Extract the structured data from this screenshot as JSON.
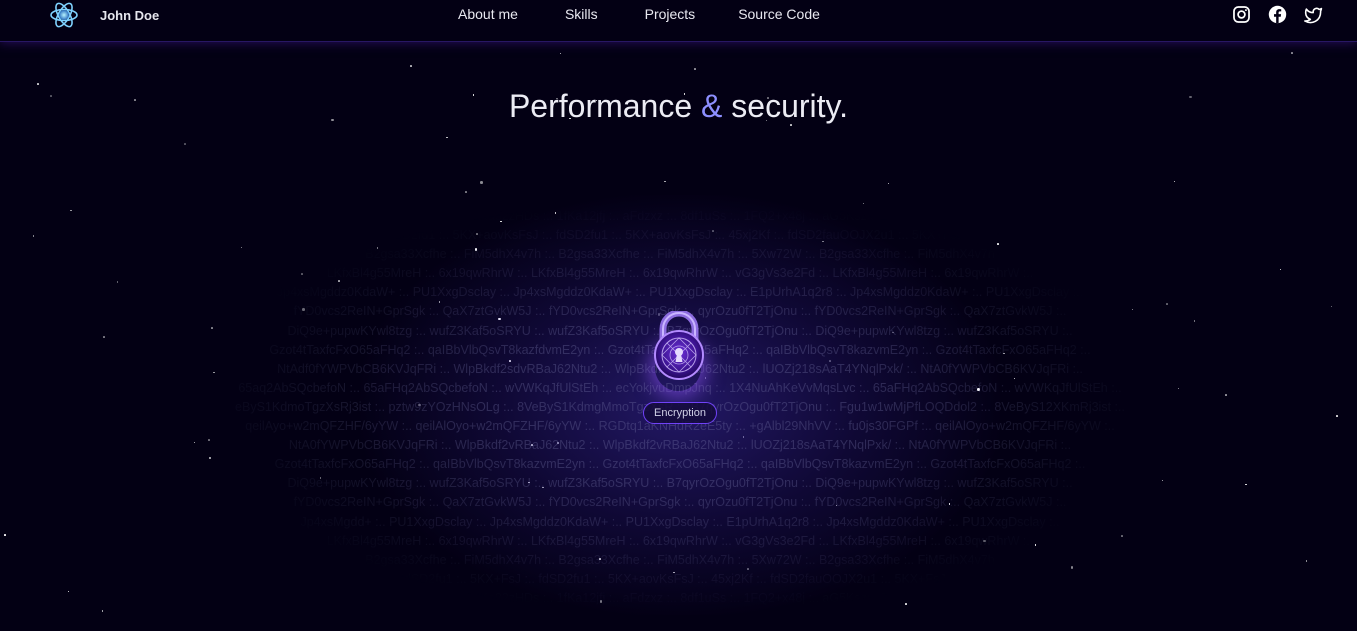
{
  "header": {
    "brand_name": "John Doe",
    "logo_icon": "atom-logo-icon",
    "nav": [
      "About me",
      "Skills",
      "Projects",
      "Source Code"
    ],
    "socials": [
      "instagram-icon",
      "facebook-icon",
      "twitter-icon"
    ]
  },
  "hero": {
    "title_part1": "Performance ",
    "title_amp": "&",
    "title_part2": " security."
  },
  "encryption": {
    "lock_icon": "lock-icon",
    "label": "Encryption",
    "background_lines": [
      "8dKa82zHDs :.. 1fKa12jfj :.. aFdzxz :.. 8df1uSs :.. 1FQ2+x48j :.. aG5Kszx+2..",
      "fdSD2fu1 :.. 5KX+aovKsFsJ :.. fdSD2fu1 :.. 5KX+aovKsFsJ :.. 45xj2Kf :.. fdSD2fauOOJX2u1 :.. 5KX+FsJ :..",
      "B2gsa33Xcfhe :.. FiM5dhX4v7h :.. B2gsa33Xcfhe :.. FiM5dhX4v7h :.. 5Xw72W :.. B2gsa33Xcfhe :.. FiM5dhX4v7h",
      "LKfxBl4g55MreH :.. 6x19qwRhrW :.. LKfxBl4g55MreH :.. 6x19qwRhrW :.. vG3gVs3e2Fd :.. LKfxBl4g55MreH :.. 6x19qwRhrW :..",
      "Jp4xsMgddz0KdaW+ :.. PU1XxgDsclay :.. Jp4xsMgddz0KdaW+ :.. PU1XxgDsclay :.. E1pUrhA1q2r8 :.. Jp4xsMgddz0KdaW+ :.. PU1XxgDsclay :..",
      "fYD0vcs2ReIN+GprSgk :.. QaX7ztGvkW5J :.. fYD0vcs2ReIN+GprSgk :.. qyrOzu0fT2TjOnu :.. fYD0vcs2ReIN+GprSgk :.. QaX7ztGvkW5J :..",
      "DiQ9e+pupwKYwl8tzg :.. wufZ3Kaf5oSRYU :.. wufZ3Kaf5oSRYU :.. B7qyrOzOgu0fT2TjOnu :.. DiQ9e+pupwKYwl8tzg :.. wufZ3Kaf5oSRYU :..",
      "Gzot4tTaxfcFxO65aFHq2 :.. qaIBbVlbQsvT8kazfdvmE2yn :.. Gzot4tTaxfcFxO65aFHq2 :.. qaIBbVlbQsvT8kazvmE2yn :.. Gzot4tTaxfcFxO65aFHq2 :..",
      "NtAdf0fYWPVbCB6KVJqFRi :.. WlpBkdf2sdvRBaJ62Ntu2 :.. WlpBkdf2vRBaJ62Ntu2 :.. lUOZj218sAaT4YNqlPxk/ :.. NtA0fYWPVbCB6KVJqFRi :..",
      "65aq2AbSQcbefoN :.. 65aFHq2AbSQcbefoN :.. wVWKqJfUlStEh :.. ecYokjvuDmpJnq :.. 1X4NuAhKeVvMqsLvc :.. 65aFHq2AbSQcbefoN :.. wVWKqJfUlStEh :..",
      "eByS1KdmoTgzXsRj3ist :.. pztw9zYOzHNsOLg :.. 8VeByS1KdmgMmoTgzXsR :.. B7qyrOzOgu0fT2TjOnu :.. Fgu1w1wMjPfLOQDdol2 :.. 8VeByS12XKmRj3ist :..",
      "qeilAyo+w2mQFZHF/6yYW :.. qeilAlOyo+w2mQFZHF/6yYW :.. RGDtq1aKNHdR2eE5ty :.. +gAlbl29NhVV :.. fu0js30FGPf :.. qeilAlOyo+w2mQFZHF/6yYW :..",
      "NtA0fYWPVbCB6KVJqFRi :.. WlpBkdf2vRBaJ62Ntu2 :.. WlpBkdf2vRBaJ62Ntu2 :.. lUOZj218sAaT4YNqlPxk/ :.. NtA0fYWPVbCB6KVJqFRi :..",
      "Gzot4tTaxfcFxO65aFHq2 :.. qaIBbVlbQsvT8kazvmE2yn :.. Gzot4tTaxfcFxO65aFHq2 :.. qaIBbVlbQsvT8kazvmE2yn :.. Gzot4tTaxfcFxO65aFHq2 :..",
      "DiQ9e+pupwKYwl8tzg :.. wufZ3Kaf5oSRYU :.. wufZ3Kaf5oSRYU :.. B7qyrOzOgu0fT2TjOnu :.. DiQ9e+pupwKYwl8tzg :.. wufZ3Kaf5oSRYU :..",
      "fYD0vcs2ReIN+GprSgk :.. QaX7ztGvkW5J :.. fYD0vcs2ReIN+GprSgk :.. qyrOzu0fT2TjOnu :.. fYD0vcs2ReIN+GprSgk :.. QaX7ztGvkW5J :..",
      "Jp4xsMgdd+ :.. PU1XxgDsclay :.. Jp4xsMgddz0KdaW+ :.. PU1XxgDsclay :.. E1pUrhA1q2r8 :.. Jp4xsMgddz0KdaW+ :.. PU1XxgDsclay :..",
      "LKfxBl4g55MreH :.. 6x19qwRhrW :.. LKfxBl4g55MreH :.. 6x19qwRhrW :.. vG3gVs3e2Fd :.. LKfxBl4g55MreH :.. 6x19qwRhrW :..",
      "B2gsa33Xcfhe :.. FiM5dhX4v7h :.. B2gsa33Xcfhe :.. FiM5dhX4v7h :.. 5Xw72W :.. B2gsa33Xcfhe :.. FiM5dhX4v7h",
      "fdSD2fu1 :.. 5KX+FsJ :.. fdSD2fu1 :.. 5KX+aovKsFsJ :.. 45xj2Kf :.. fdSD2fauOOJX2u1 :.. 5KX+FsJ :..",
      "8dKa82zHDs :.. 1fKa12jfj :.. aFdzxz :.. 8df1uSs :.. 1FQ2+x48j :.. aG5Kszx+2.."
    ]
  },
  "colors": {
    "background": "#030014",
    "accent": "#7042f8",
    "ampersand": "#8d8fff"
  }
}
